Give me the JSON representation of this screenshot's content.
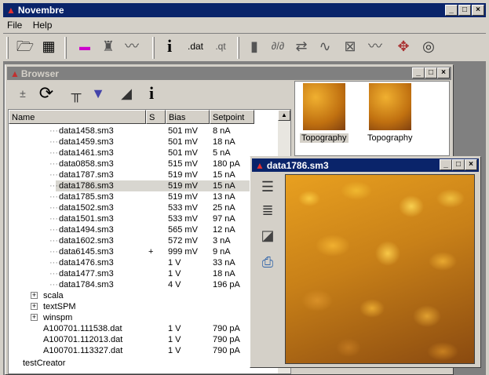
{
  "app": {
    "title": "Novembre",
    "menu": [
      "File",
      "Help"
    ]
  },
  "toolbar": {
    "icons": [
      "open-folder-icon",
      "layout-grid-icon",
      "color-palette-icon",
      "filter-person-icon",
      "curve-icon",
      "info-icon",
      "dat-export-icon",
      "qt-export-icon",
      "bars-icon",
      "derivative-icon",
      "arrows-icon",
      "fit-curve-icon",
      "compare-icon",
      "profile-icon",
      "points-icon",
      "spiral-icon"
    ],
    "dat_label": ".dat",
    "qt_label": ".qt"
  },
  "browser": {
    "title": "Browser",
    "columns": [
      "Name",
      "S",
      "Bias",
      "Setpoint"
    ],
    "rows": [
      {
        "name": "data1458.sm3",
        "s": "",
        "bias": "501 mV",
        "setpoint": "8 nA"
      },
      {
        "name": "data1459.sm3",
        "s": "",
        "bias": "501 mV",
        "setpoint": "18 nA"
      },
      {
        "name": "data1461.sm3",
        "s": "",
        "bias": "501 mV",
        "setpoint": "5 nA"
      },
      {
        "name": "data0858.sm3",
        "s": "",
        "bias": "515 mV",
        "setpoint": "180 pA"
      },
      {
        "name": "data1787.sm3",
        "s": "",
        "bias": "519 mV",
        "setpoint": "15 nA"
      },
      {
        "name": "data1786.sm3",
        "s": "",
        "bias": "519 mV",
        "setpoint": "15 nA",
        "selected": true
      },
      {
        "name": "data1785.sm3",
        "s": "",
        "bias": "519 mV",
        "setpoint": "13 nA"
      },
      {
        "name": "data1502.sm3",
        "s": "",
        "bias": "533 mV",
        "setpoint": "25 nA"
      },
      {
        "name": "data1501.sm3",
        "s": "",
        "bias": "533 mV",
        "setpoint": "97 nA"
      },
      {
        "name": "data1494.sm3",
        "s": "",
        "bias": "565 mV",
        "setpoint": "12 nA"
      },
      {
        "name": "data1602.sm3",
        "s": "",
        "bias": "572 mV",
        "setpoint": "3 nA"
      },
      {
        "name": "data6145.sm3",
        "s": "+",
        "bias": "999 mV",
        "setpoint": "9 nA"
      },
      {
        "name": "data1476.sm3",
        "s": "",
        "bias": "1 V",
        "setpoint": "33 nA"
      },
      {
        "name": "data1477.sm3",
        "s": "",
        "bias": "1 V",
        "setpoint": "18 nA"
      },
      {
        "name": "data1784.sm3",
        "s": "",
        "bias": "4 V",
        "setpoint": "196 pA"
      }
    ],
    "folders": [
      "scala",
      "textSPM",
      "winspm"
    ],
    "files": [
      {
        "name": "A100701.111538.dat",
        "bias": "1 V",
        "setpoint": "790 pA"
      },
      {
        "name": "A100701.112013.dat",
        "bias": "1 V",
        "setpoint": "790 pA"
      },
      {
        "name": "A100701.113327.dat",
        "bias": "1 V",
        "setpoint": "790 pA"
      }
    ],
    "partial": "testCreator",
    "thumbnails": [
      "Topography",
      "Topography"
    ]
  },
  "viewer": {
    "title": "data1786.sm3"
  }
}
